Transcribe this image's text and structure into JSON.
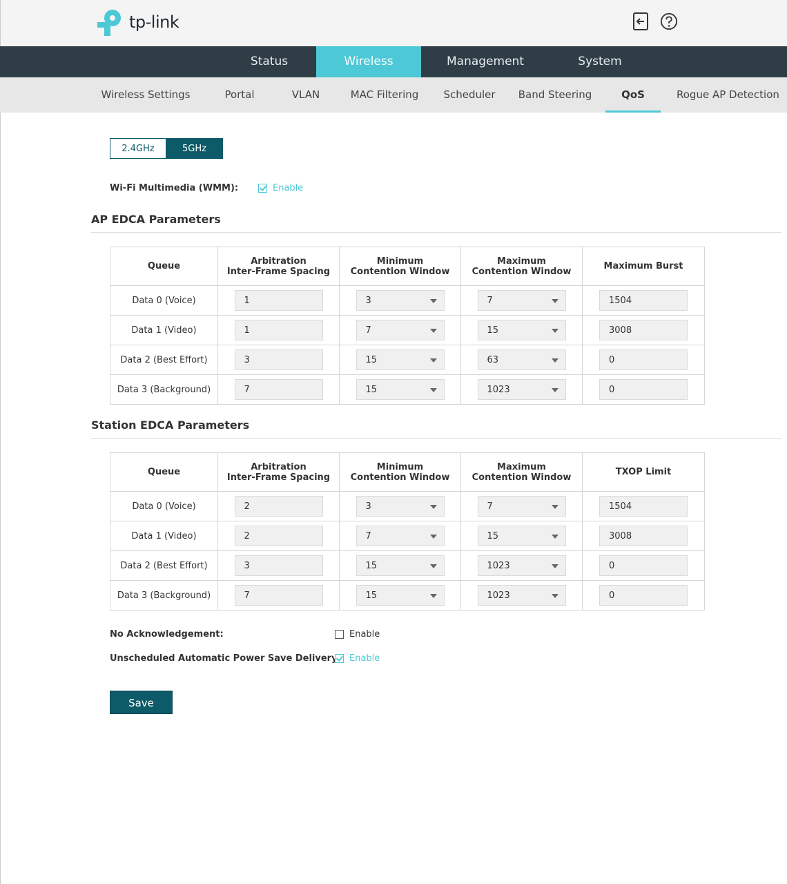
{
  "header": {
    "logo_text": "tp-link",
    "icons": [
      "logout-icon",
      "help-icon"
    ]
  },
  "main_nav": [
    {
      "label": "Status",
      "active": false
    },
    {
      "label": "Wireless",
      "active": true
    },
    {
      "label": "Management",
      "active": false
    },
    {
      "label": "System",
      "active": false
    }
  ],
  "sub_nav": [
    {
      "label": "Wireless Settings",
      "active": false
    },
    {
      "label": "Portal",
      "active": false
    },
    {
      "label": "VLAN",
      "active": false
    },
    {
      "label": "MAC Filtering",
      "active": false
    },
    {
      "label": "Scheduler",
      "active": false
    },
    {
      "label": "Band Steering",
      "active": false
    },
    {
      "label": "QoS",
      "active": true
    },
    {
      "label": "Rogue AP Detection",
      "active": false
    }
  ],
  "band": {
    "option_a": "2.4GHz",
    "option_b": "5GHz",
    "selected": "5GHz"
  },
  "wmm": {
    "label": "Wi-Fi Multimedia (WMM):",
    "checkbox_label": "Enable",
    "checked": true
  },
  "ap_edca": {
    "title": "AP EDCA Parameters",
    "headers": {
      "queue": "Queue",
      "aifs_1": "Arbitration",
      "aifs_2": "Inter-Frame Spacing",
      "cwmin_1": "Minimum",
      "cwmin_2": "Contention Window",
      "cwmax_1": "Maximum",
      "cwmax_2": "Contention Window",
      "last": "Maximum Burst"
    },
    "rows": [
      {
        "queue": "Data 0 (Voice)",
        "aifs": "1",
        "cwmin": "3",
        "cwmax": "7",
        "last": "1504"
      },
      {
        "queue": "Data 1 (Video)",
        "aifs": "1",
        "cwmin": "7",
        "cwmax": "15",
        "last": "3008"
      },
      {
        "queue": "Data 2 (Best Effort)",
        "aifs": "3",
        "cwmin": "15",
        "cwmax": "63",
        "last": "0"
      },
      {
        "queue": "Data 3 (Background)",
        "aifs": "7",
        "cwmin": "15",
        "cwmax": "1023",
        "last": "0"
      }
    ]
  },
  "sta_edca": {
    "title": "Station EDCA Parameters",
    "headers": {
      "queue": "Queue",
      "aifs_1": "Arbitration",
      "aifs_2": "Inter-Frame Spacing",
      "cwmin_1": "Minimum",
      "cwmin_2": "Contention Window",
      "cwmax_1": "Maximum",
      "cwmax_2": "Contention Window",
      "last": "TXOP Limit"
    },
    "rows": [
      {
        "queue": "Data 0 (Voice)",
        "aifs": "2",
        "cwmin": "3",
        "cwmax": "7",
        "last": "1504"
      },
      {
        "queue": "Data 1 (Video)",
        "aifs": "2",
        "cwmin": "7",
        "cwmax": "15",
        "last": "3008"
      },
      {
        "queue": "Data 2 (Best Effort)",
        "aifs": "3",
        "cwmin": "15",
        "cwmax": "1023",
        "last": "0"
      },
      {
        "queue": "Data 3 (Background)",
        "aifs": "7",
        "cwmin": "15",
        "cwmax": "1023",
        "last": "0"
      }
    ]
  },
  "no_ack": {
    "label": "No Acknowledgement:",
    "checkbox_label": "Enable",
    "checked": false
  },
  "uapsd": {
    "label": "Unscheduled Automatic Power Save Delivery:",
    "checkbox_label": "Enable",
    "checked": true
  },
  "save_label": "Save",
  "colors": {
    "accent": "#4cc8d6",
    "primary": "#0d5a68",
    "nav_bg": "#2f3e46",
    "subnav_bg": "#e7e7e7"
  }
}
